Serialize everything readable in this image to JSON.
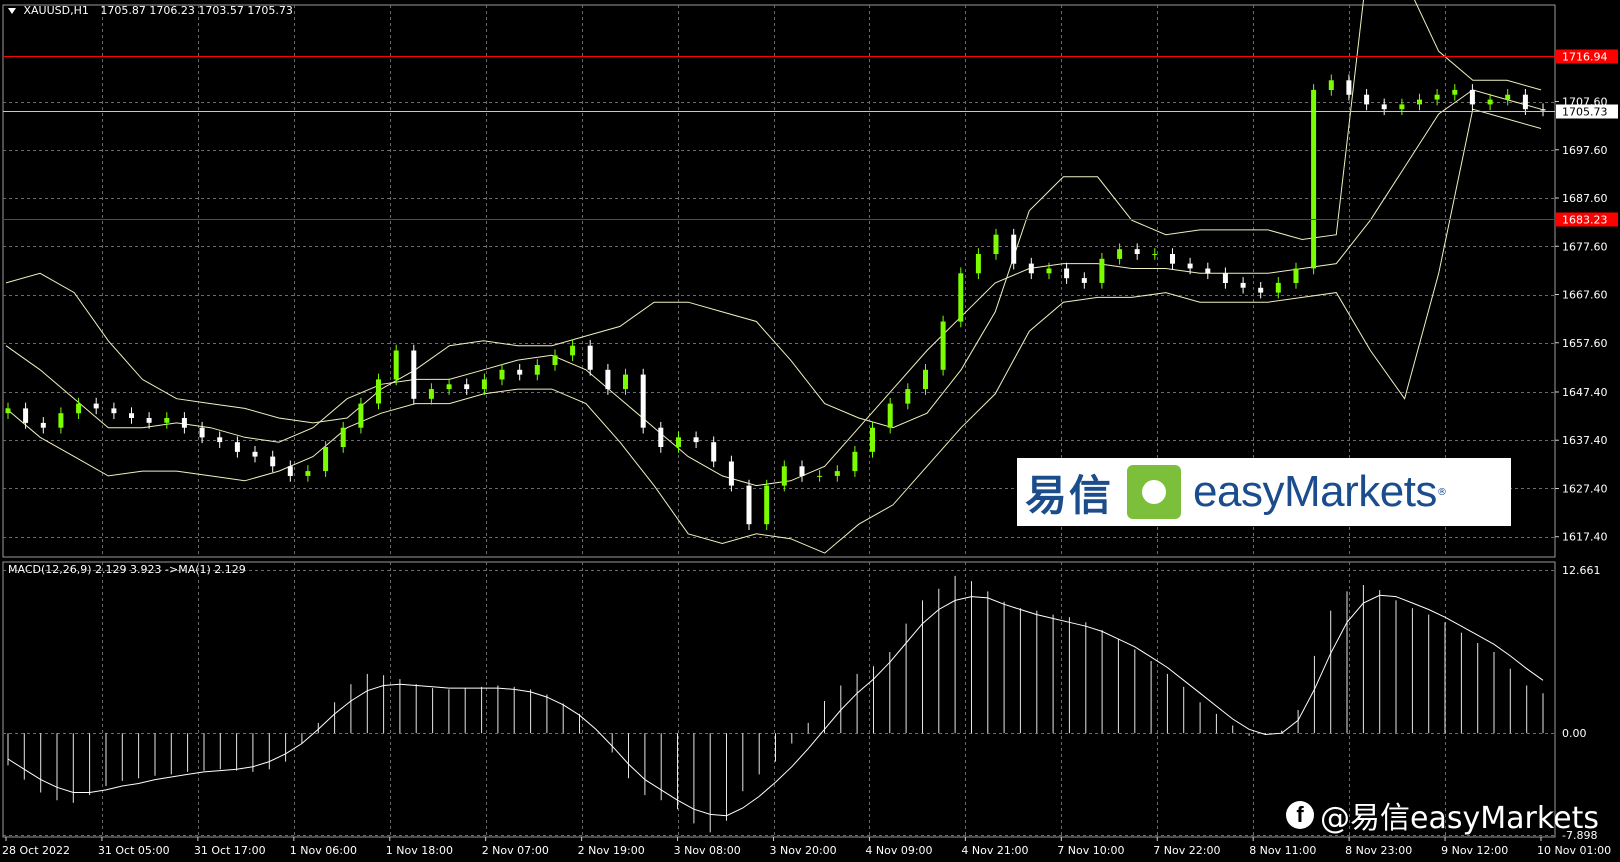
{
  "symbol_info": {
    "symbol": "XAUUSD,H1",
    "ohlc": "1705.87 1706.23 1703.57 1705.73"
  },
  "macd_info": "MACD(12,26,9) 2.129 3.923  ->MA(1) 2.129",
  "colors": {
    "background": "#000000",
    "grid": "#6b6b6b",
    "bull": "#7CFC00",
    "bear": "#ffffff",
    "band": "#f0f0c0",
    "level": "#ff0000",
    "level_label_bg": "#ff0000"
  },
  "levels": [
    {
      "price": 1716.94,
      "label": "1716.94"
    },
    {
      "price": 1683.23,
      "label": "1683.23"
    }
  ],
  "current_price": {
    "price": 1705.73,
    "label": "1705.73"
  },
  "logo": {
    "cn": "易信",
    "en": "easyMarkets",
    "reg": "®"
  },
  "watermark": {
    "icon": "facebook-icon",
    "icon_glyph": "f",
    "text": "@易信easyMarkets"
  },
  "chart_data": [
    {
      "type": "candlestick",
      "title": "XAUUSD,H1",
      "price_axis_ticks": [
        "1707.60",
        "1697.60",
        "1687.60",
        "1677.60",
        "1667.60",
        "1657.60",
        "1647.40",
        "1637.40",
        "1627.40",
        "1617.40"
      ],
      "price_axis_values": [
        1707.6,
        1697.6,
        1687.6,
        1677.6,
        1667.6,
        1657.6,
        1647.4,
        1637.4,
        1627.4,
        1617.4
      ],
      "ylim": [
        1613.2,
        1727.6
      ],
      "time_labels": [
        "28 Oct 2022",
        "31 Oct 05:00",
        "31 Oct 17:00",
        "1 Nov 06:00",
        "1 Nov 18:00",
        "2 Nov 07:00",
        "2 Nov 19:00",
        "3 Nov 08:00",
        "3 Nov 20:00",
        "4 Nov 09:00",
        "4 Nov 21:00",
        "7 Nov 10:00",
        "7 Nov 22:00",
        "8 Nov 11:00",
        "8 Nov 23:00",
        "9 Nov 12:00",
        "10 Nov 01:00"
      ],
      "indicator": "Bollinger Bands",
      "close_series": [
        1644,
        1641,
        1640,
        1643,
        1645,
        1644,
        1643,
        1642,
        1641,
        1642,
        1640,
        1638,
        1637,
        1635,
        1634,
        1632,
        1630,
        1631,
        1636,
        1640,
        1645,
        1650,
        1656,
        1646,
        1648,
        1649,
        1648,
        1650,
        1652,
        1651,
        1653,
        1655,
        1657,
        1652,
        1648,
        1651,
        1640,
        1636,
        1638,
        1637,
        1633,
        1628,
        1620,
        1628,
        1632,
        1630,
        1630,
        1631,
        1635,
        1640,
        1645,
        1648,
        1652,
        1662,
        1672,
        1676,
        1680,
        1674,
        1672,
        1673,
        1671,
        1670,
        1675,
        1677,
        1676,
        1676,
        1674,
        1673,
        1672,
        1670,
        1669,
        1668,
        1670,
        1673,
        1710,
        1712,
        1709,
        1707,
        1706,
        1707,
        1708,
        1709,
        1710,
        1707,
        1708,
        1709,
        1706,
        1705.73
      ],
      "bands": {
        "upper": [
          1670,
          1672,
          1668,
          1658,
          1650,
          1646,
          1645,
          1644,
          1642,
          1641,
          1642,
          1648,
          1652,
          1657,
          1658,
          1657,
          1657,
          1659,
          1661,
          1666,
          1666,
          1664,
          1662,
          1654,
          1645,
          1642,
          1640,
          1643,
          1652,
          1664,
          1685,
          1692,
          1692,
          1683,
          1680,
          1681,
          1681,
          1681,
          1679,
          1680,
          1741,
          1733,
          1718,
          1712,
          1712,
          1710
        ],
        "middle": [
          1657,
          1652,
          1646,
          1640,
          1640,
          1641,
          1640,
          1638,
          1637,
          1640,
          1646,
          1649,
          1650,
          1650,
          1652,
          1654,
          1655,
          1652,
          1646,
          1640,
          1634,
          1630,
          1628,
          1629,
          1632,
          1640,
          1648,
          1656,
          1663,
          1670,
          1673,
          1674,
          1674,
          1673,
          1673,
          1672,
          1672,
          1672,
          1673,
          1674,
          1683,
          1694,
          1705,
          1710,
          1708,
          1706
        ],
        "lower": [
          1644,
          1638,
          1634,
          1630,
          1631,
          1631,
          1630,
          1629,
          1631,
          1634,
          1640,
          1643,
          1645,
          1645,
          1647,
          1648,
          1648,
          1645,
          1637,
          1628,
          1618,
          1616,
          1618,
          1617,
          1614,
          1620,
          1624,
          1632,
          1640,
          1647,
          1660,
          1666,
          1667,
          1667,
          1668,
          1666,
          1666,
          1666,
          1667,
          1668,
          1656,
          1646,
          1672,
          1706,
          1704,
          1702
        ]
      }
    },
    {
      "type": "bar",
      "title": "MACD(12,26,9)",
      "ylim": [
        -7.898,
        12.661
      ],
      "axis_ticks": [
        "12.661",
        "0.00",
        "-7.898"
      ],
      "axis_values": [
        12.661,
        0.0,
        -7.898
      ],
      "histogram": [
        -2.5,
        -3.6,
        -4.6,
        -5.2,
        -5.4,
        -4.8,
        -4.1,
        -3.7,
        -3.5,
        -3.3,
        -3.2,
        -3.0,
        -2.9,
        -2.8,
        -2.9,
        -3.0,
        -2.8,
        -2.2,
        -0.8,
        0.8,
        2.4,
        3.8,
        4.6,
        4.5,
        4.2,
        3.8,
        3.5,
        3.4,
        3.5,
        3.6,
        3.7,
        3.6,
        3.4,
        3.0,
        2.3,
        1.5,
        0.0,
        -1.5,
        -3.5,
        -4.8,
        -5.2,
        -5.9,
        -7.0,
        -7.7,
        -6.8,
        -4.5,
        -3.2,
        -2.2,
        -0.8,
        0.8,
        2.5,
        3.7,
        4.6,
        5.2,
        6.3,
        8.5,
        10.3,
        11.2,
        12.2,
        11.8,
        11.0,
        10.2,
        9.7,
        9.5,
        9.2,
        9.0,
        8.6,
        8.0,
        7.3,
        6.5,
        5.6,
        4.6,
        3.6,
        2.4,
        1.5,
        0.6,
        -0.2,
        -0.1,
        0.2,
        1.8,
        6.0,
        9.5,
        11.0,
        11.5,
        11.1,
        10.3,
        9.7,
        9.2,
        8.6,
        7.8,
        7.0,
        6.3,
        5.0,
        3.7,
        3.1
      ],
      "signal": [
        -2.0,
        -2.8,
        -3.6,
        -4.2,
        -4.6,
        -4.6,
        -4.4,
        -4.1,
        -3.9,
        -3.6,
        -3.4,
        -3.2,
        -3.0,
        -2.9,
        -2.8,
        -2.6,
        -2.2,
        -1.6,
        -0.8,
        0.3,
        1.5,
        2.5,
        3.3,
        3.7,
        3.8,
        3.7,
        3.6,
        3.5,
        3.5,
        3.5,
        3.5,
        3.4,
        3.2,
        2.8,
        2.2,
        1.4,
        0.3,
        -1.0,
        -2.4,
        -3.6,
        -4.4,
        -5.2,
        -5.9,
        -6.3,
        -6.4,
        -5.8,
        -4.9,
        -3.8,
        -2.6,
        -1.2,
        0.3,
        1.8,
        3.1,
        4.2,
        5.5,
        7.0,
        8.5,
        9.6,
        10.3,
        10.6,
        10.5,
        10.0,
        9.6,
        9.2,
        8.9,
        8.6,
        8.3,
        7.9,
        7.3,
        6.7,
        5.9,
        5.1,
        4.1,
        3.1,
        2.1,
        1.1,
        0.3,
        -0.1,
        0.0,
        1.0,
        3.4,
        6.2,
        8.6,
        10.1,
        10.7,
        10.6,
        10.1,
        9.6,
        9.0,
        8.3,
        7.6,
        6.9,
        6.0,
        5.0,
        4.1
      ]
    }
  ]
}
